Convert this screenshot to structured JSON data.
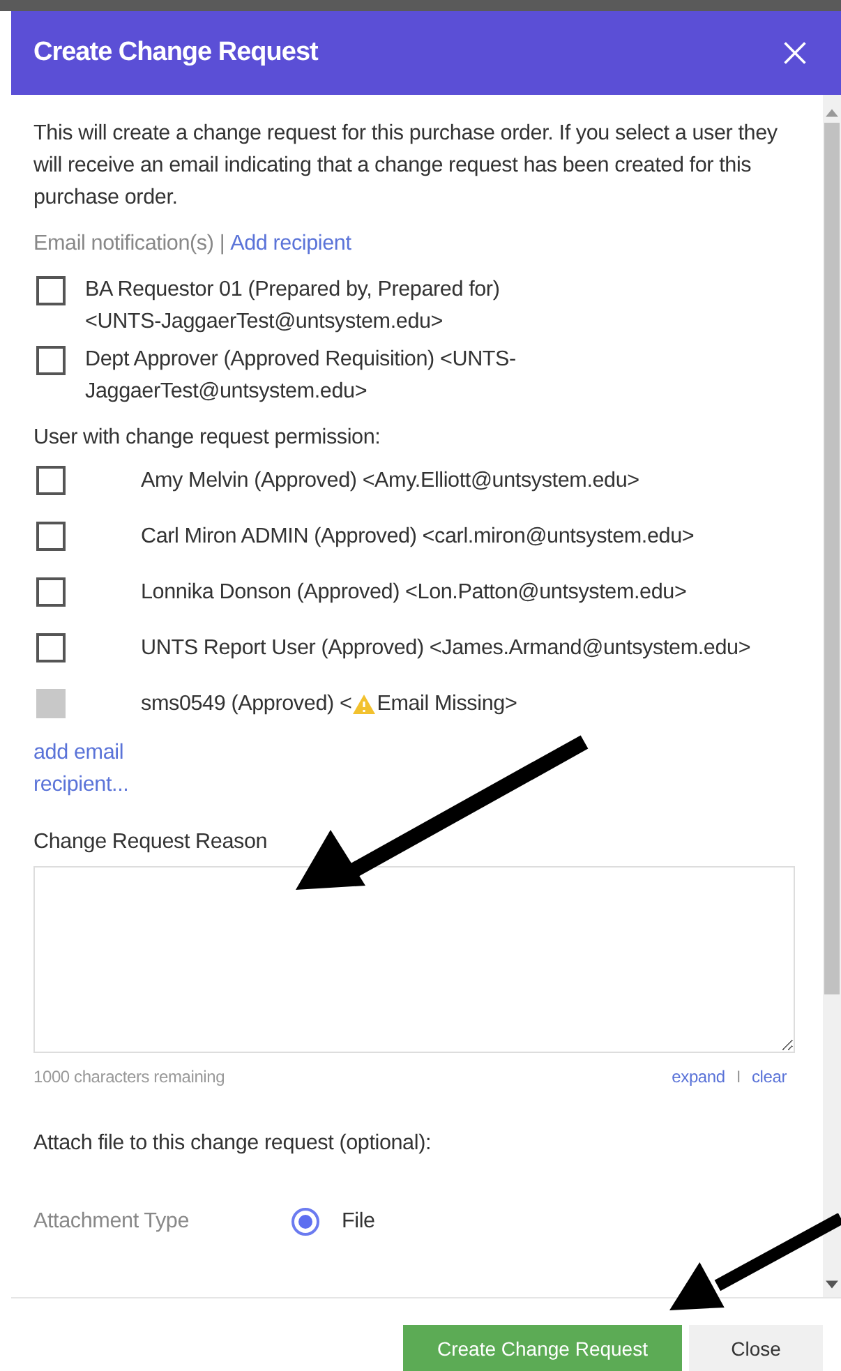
{
  "dialog": {
    "title": "Create Change Request"
  },
  "intro": "This will create a change request for this purchase order. If you select a user they will receive an email indicating that a change request has been created for this purchase order.",
  "notifications": {
    "label": "Email notification(s) |",
    "link": "Add recipient",
    "items": [
      {
        "label": "BA Requestor 01 (Prepared by, Prepared for) <UNTS-JaggaerTest@untsystem.edu>",
        "checked": false
      },
      {
        "label": "Dept Approver (Approved Requisition) <UNTS-JaggaerTest@untsystem.edu>",
        "checked": false
      }
    ]
  },
  "permission": {
    "label": "User with change request permission:",
    "items": [
      {
        "label": "Amy Melvin (Approved) <Amy.Elliott@untsystem.edu>",
        "checked": false,
        "disabled": false
      },
      {
        "label": "Carl Miron ADMIN (Approved) <carl.miron@untsystem.edu>",
        "checked": false,
        "disabled": false
      },
      {
        "label": "Lonnika Donson (Approved) <Lon.Patton@untsystem.edu>",
        "checked": false,
        "disabled": false
      },
      {
        "label": "UNTS Report User (Approved) <James.Armand@untsystem.edu>",
        "checked": false,
        "disabled": false
      },
      {
        "label": "sms0549 (Approved) <",
        "warning": "Email Missing>",
        "checked": false,
        "disabled": true
      }
    ]
  },
  "add_email_link": "add email recipient...",
  "reason": {
    "label": "Change Request Reason",
    "counter": "1000 characters remaining",
    "links": [
      "expand",
      "clear"
    ],
    "separator": "I"
  },
  "attach": {
    "label": "Attach file to this change request (optional):",
    "type_label": "Attachment Type",
    "options": [
      {
        "label": "File",
        "selected": true
      }
    ]
  },
  "buttons": [
    {
      "label": "Create Change Request",
      "kind": "primary"
    },
    {
      "label": "Close",
      "kind": "secondary"
    }
  ]
}
